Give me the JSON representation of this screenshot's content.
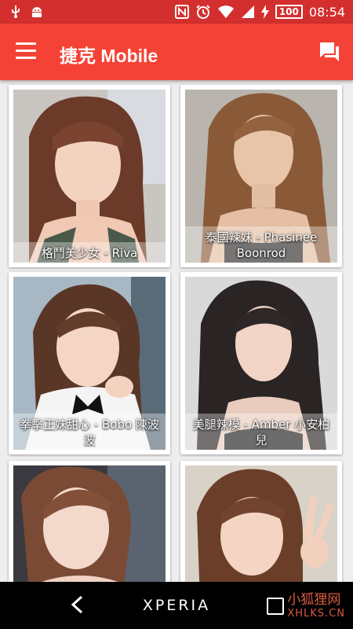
{
  "status_bar": {
    "icons": [
      "usb-icon",
      "android-icon",
      "nfc-icon",
      "alarm-icon",
      "wifi-icon",
      "signal-icon",
      "charging-icon"
    ],
    "battery": "100",
    "time": "08:54"
  },
  "app_bar": {
    "title": "捷克 Mobile",
    "menu_icon": "menu-icon",
    "action_icon": "chat-icon"
  },
  "cards": [
    {
      "caption": "格鬥美少女 - Riva"
    },
    {
      "caption": "泰國辣妹 - Phasinee Boonrod"
    },
    {
      "caption": "拳擊正妹甜心 - Bobo 陳波波"
    },
    {
      "caption": "美腿辣模 - Amber 小安柏兒"
    },
    {
      "caption": ""
    },
    {
      "caption": ""
    }
  ],
  "nav_bar": {
    "brand": "XPERIA",
    "back_icon": "back-icon",
    "recent_icon": "recent-apps-icon"
  },
  "watermark": {
    "line1": "小狐狸网",
    "line2": "XHLKS.CN"
  },
  "colors": {
    "app_bar": "#f44336",
    "status_bar": "#d32f2f",
    "background": "#eeeeee"
  }
}
